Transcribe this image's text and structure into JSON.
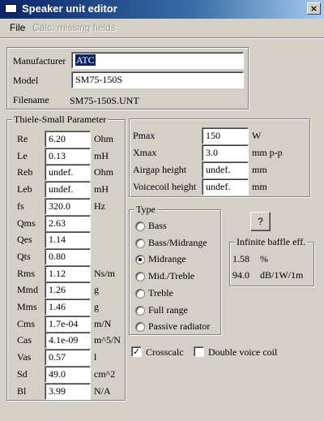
{
  "window": {
    "title": "Speaker unit editor",
    "close_glyph": "×"
  },
  "menu": {
    "file": "File",
    "calc_missing": "Calc. missing fields"
  },
  "header": {
    "manufacturer_label": "Manufacturer",
    "manufacturer_value": "ATC",
    "model_label": "Model",
    "model_value": "SM75-150S",
    "filename_label": "Filename",
    "filename_value": "SM75-150S.UNT"
  },
  "ts": {
    "title": "Thiele-Small Parameter",
    "params": [
      {
        "name": "Re",
        "value": "6.20",
        "unit": "Ohm"
      },
      {
        "name": "Le",
        "value": "0.13",
        "unit": "mH"
      },
      {
        "name": "Reb",
        "value": "undef.",
        "unit": "Ohm"
      },
      {
        "name": "Leb",
        "value": "undef.",
        "unit": "mH"
      },
      {
        "name": "fs",
        "value": "320.0",
        "unit": "Hz"
      },
      {
        "name": "Qms",
        "value": "2.63",
        "unit": ""
      },
      {
        "name": "Qes",
        "value": "1.14",
        "unit": ""
      },
      {
        "name": "Qts",
        "value": "0.80",
        "unit": ""
      },
      {
        "name": "Rms",
        "value": "1.12",
        "unit": "Ns/m"
      },
      {
        "name": "Mmd",
        "value": "1.26",
        "unit": "g"
      },
      {
        "name": "Mms",
        "value": "1.46",
        "unit": "g"
      },
      {
        "name": "Cms",
        "value": "1.7e-04",
        "unit": "m/N"
      },
      {
        "name": "Cas",
        "value": "4.1e-09",
        "unit": "m^5/N"
      },
      {
        "name": "Vas",
        "value": "0.57",
        "unit": "l"
      },
      {
        "name": "Sd",
        "value": "49.0",
        "unit": "cm^2"
      },
      {
        "name": "Bl",
        "value": "3.99",
        "unit": "N/A"
      }
    ]
  },
  "power": {
    "rows": [
      {
        "name": "Pmax",
        "value": "150",
        "unit": "W"
      },
      {
        "name": "Xmax",
        "value": "3.0",
        "unit": "mm p-p"
      },
      {
        "name": "Airgap height",
        "value": "undef.",
        "unit": "mm"
      },
      {
        "name": "Voicecoil height",
        "value": "undef.",
        "unit": "mm"
      }
    ]
  },
  "type": {
    "title": "Type",
    "options": [
      "Bass",
      "Bass/Midrange",
      "Midrange",
      "Mid./Treble",
      "Treble",
      "Full range",
      "Passive radiator"
    ],
    "selected": "Midrange"
  },
  "help_button": "?",
  "baffle": {
    "title": "Infinite baffle eff.",
    "rows": [
      {
        "value": "1.58",
        "unit": "%"
      },
      {
        "value": "94.0",
        "unit": "dB/1W/1m"
      }
    ]
  },
  "options": {
    "crosscalc_label": "Crosscalc",
    "crosscalc_checked": true,
    "double_vc_label": "Double voice coil",
    "double_vc_checked": false
  }
}
